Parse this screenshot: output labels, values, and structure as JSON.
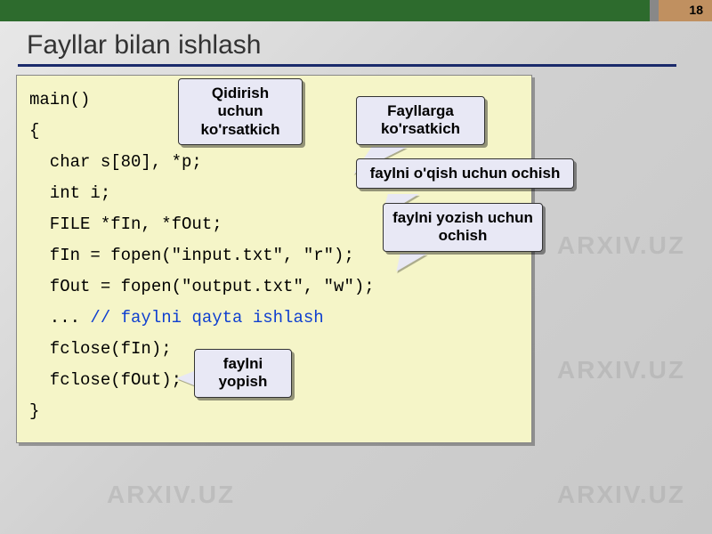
{
  "page_number": "18",
  "title": "Fayllar bilan ishlash",
  "watermark_text": "ARXIV.UZ",
  "code": {
    "line1": "main()",
    "line2": "{",
    "line3": "  char s[80], *p;",
    "line4": "  int i;",
    "line5": "  FILE *fIn, *fOut;",
    "line6": "  fIn = fopen(\"input.txt\", \"r\");",
    "line7": "  fOut = fopen(\"output.txt\", \"w\");",
    "line8a": "  ... ",
    "line8b": "// faylni qayta ishlash",
    "line9": "  fclose(fIn);",
    "line10": "  fclose(fOut);",
    "line11": "}"
  },
  "callouts": {
    "c1": "Qidirish uchun ko'rsatkich",
    "c2": "Fayllarga ko'rsatkich",
    "c3": "faylni o'qish uchun ochish",
    "c4": "faylni yozish uchun ochish",
    "c5": "faylni yopish"
  }
}
